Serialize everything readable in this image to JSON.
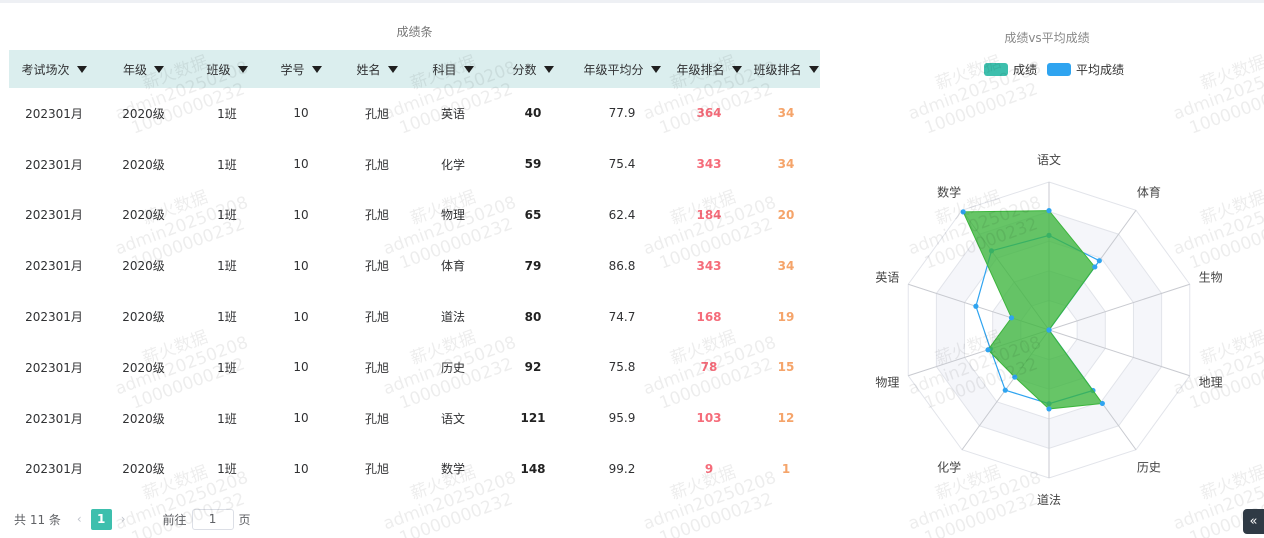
{
  "table": {
    "title": "成绩条",
    "columns": [
      "考试场次",
      "年级",
      "班级",
      "学号",
      "姓名",
      "科目",
      "分数",
      "年级平均分",
      "年级排名",
      "班级排名"
    ],
    "rows": [
      [
        "202301月",
        "2020级",
        "1班",
        "10",
        "孔旭",
        "英语",
        "40",
        "77.9",
        "364",
        "34"
      ],
      [
        "202301月",
        "2020级",
        "1班",
        "10",
        "孔旭",
        "化学",
        "59",
        "75.4",
        "343",
        "34"
      ],
      [
        "202301月",
        "2020级",
        "1班",
        "10",
        "孔旭",
        "物理",
        "65",
        "62.4",
        "184",
        "20"
      ],
      [
        "202301月",
        "2020级",
        "1班",
        "10",
        "孔旭",
        "体育",
        "79",
        "86.8",
        "343",
        "34"
      ],
      [
        "202301月",
        "2020级",
        "1班",
        "10",
        "孔旭",
        "道法",
        "80",
        "74.7",
        "168",
        "19"
      ],
      [
        "202301月",
        "2020级",
        "1班",
        "10",
        "孔旭",
        "历史",
        "92",
        "75.8",
        "78",
        "15"
      ],
      [
        "202301月",
        "2020级",
        "1班",
        "10",
        "孔旭",
        "语文",
        "121",
        "95.9",
        "103",
        "12"
      ],
      [
        "202301月",
        "2020级",
        "1班",
        "10",
        "孔旭",
        "数学",
        "148",
        "99.2",
        "9",
        "1"
      ]
    ]
  },
  "pagination": {
    "total": "共 11 条",
    "prev_icon": "‹",
    "current_page": "1",
    "next_icon": "›",
    "goto_label": "前往",
    "goto_value": "1",
    "page_suffix": "页"
  },
  "watermark": {
    "line1": "薪火数据",
    "line2": "admin20250208",
    "line3": "10000000232"
  },
  "radar": {
    "title": "成绩vs平均成绩",
    "legend": [
      {
        "name": "成绩",
        "color": "#3dbfad"
      },
      {
        "name": "平均成绩",
        "color": "#2fa4f0"
      }
    ],
    "indicators": [
      "语文",
      "体育",
      "生物",
      "地理",
      "历史",
      "道法",
      "化学",
      "物理",
      "英语",
      "数学"
    ],
    "score_color": "#3cb53c",
    "average_color": "#2fa4f0"
  },
  "chart_data": {
    "type": "radar",
    "title": "成绩vs平均成绩",
    "indicators": [
      "语文",
      "体育",
      "生物",
      "地理",
      "历史",
      "道法",
      "化学",
      "物理",
      "英语",
      "数学"
    ],
    "max": 150,
    "series": [
      {
        "name": "成绩",
        "values": [
          121,
          79,
          0,
          0,
          92,
          80,
          59,
          65,
          40,
          148
        ]
      },
      {
        "name": "平均成绩",
        "values": [
          95.9,
          86.8,
          0,
          0,
          75.8,
          74.7,
          75.4,
          62.4,
          77.9,
          99.2
        ]
      }
    ]
  },
  "corner_button_icon": "«"
}
